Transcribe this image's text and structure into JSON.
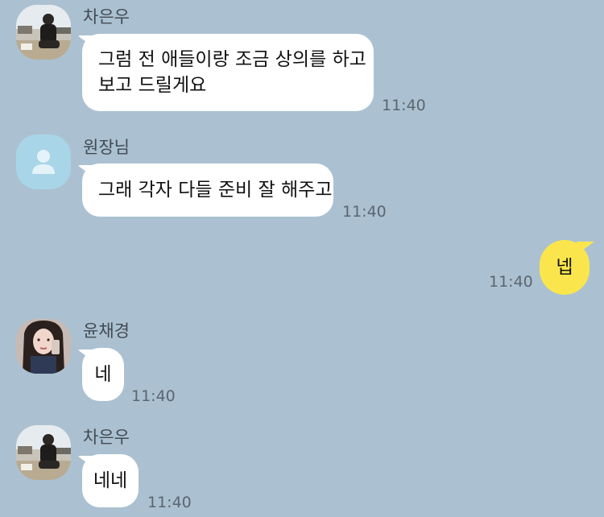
{
  "messages": [
    {
      "sender": "차은우",
      "lines": [
        "그럼 전 애들이랑 조금 상의를 하고",
        "보고 드릴게요"
      ],
      "time": "11:40"
    },
    {
      "sender": "원장님",
      "lines": [
        "그래 각자 다들 준비 잘 해주고"
      ],
      "time": "11:40"
    },
    {
      "sender": "",
      "lines": [
        "넵"
      ],
      "time": "11:40"
    },
    {
      "sender": "윤채경",
      "lines": [
        "네"
      ],
      "time": "11:40"
    },
    {
      "sender": "차은우",
      "lines": [
        "네네"
      ],
      "time": "11:40"
    }
  ],
  "icons": {
    "default_avatar": "person-icon"
  },
  "colors": {
    "background": "#abc1d1",
    "incoming_bubble": "#ffffff",
    "outgoing_bubble": "#fae64c",
    "default_avatar": "#a9d5e8"
  }
}
